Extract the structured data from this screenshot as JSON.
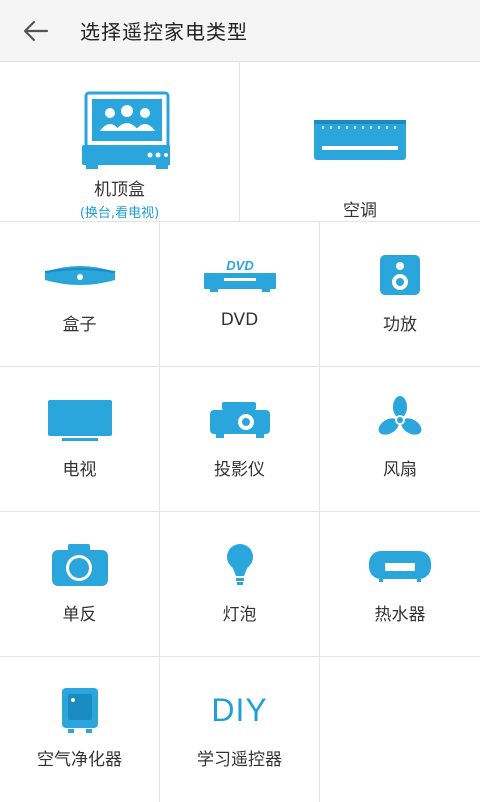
{
  "header": {
    "title": "选择遥控家电类型"
  },
  "icons": {
    "back": "arrow-left-icon"
  },
  "accent_color": "#2aa6dc",
  "devices": {
    "stb": {
      "label": "机顶盒",
      "sub": "(换台,看电视)"
    },
    "ac": {
      "label": "空调"
    },
    "box": {
      "label": "盒子"
    },
    "dvd": {
      "label": "DVD",
      "logo": "DVD"
    },
    "amp": {
      "label": "功放"
    },
    "tv": {
      "label": "电视"
    },
    "projector": {
      "label": "投影仪"
    },
    "fan": {
      "label": "风扇"
    },
    "camera": {
      "label": "单反"
    },
    "bulb": {
      "label": "灯泡"
    },
    "heater": {
      "label": "热水器"
    },
    "purifier": {
      "label": "空气净化器"
    },
    "diy": {
      "label": "学习遥控器",
      "text": "DIY"
    }
  }
}
